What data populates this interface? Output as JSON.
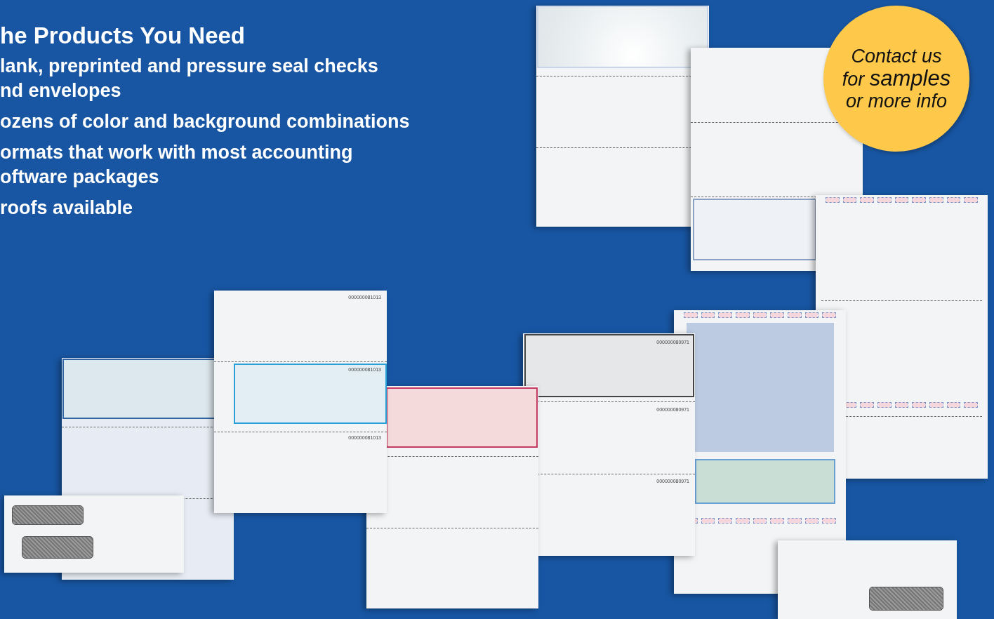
{
  "heading": "he Products You Need",
  "bullets": [
    {
      "lines": [
        "lank, preprinted and pressure seal checks",
        "nd envelopes"
      ]
    },
    {
      "lines": [
        "ozens of color and background combinations"
      ]
    },
    {
      "lines": [
        "ormats that work with most accounting",
        "oftware packages"
      ]
    },
    {
      "lines": [
        "roofs available"
      ]
    }
  ],
  "products": [
    {
      "kind": "blank-top"
    },
    {
      "kind": "blank-bottom"
    },
    {
      "kind": "pressure-seal"
    },
    {
      "kind": "pressure-seal-color"
    },
    {
      "kind": "envelope"
    },
    {
      "kind": "check-top",
      "numbers": [
        "000000080971",
        "000000080971",
        "000000080971"
      ]
    },
    {
      "kind": "check-top-pink"
    },
    {
      "kind": "check-middle",
      "numbers": [
        "000000081013",
        "000000081013",
        "000000081013"
      ]
    },
    {
      "kind": "check-top-green"
    },
    {
      "kind": "envelope-double"
    }
  ],
  "callout": {
    "lines": [
      {
        "text": "Contact us"
      },
      {
        "text": "for ",
        "emphasis": "samples"
      },
      {
        "text": "or more info"
      }
    ]
  }
}
